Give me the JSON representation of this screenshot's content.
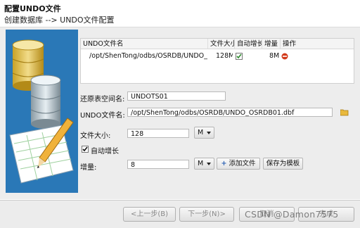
{
  "header": {
    "title": "配置UNDO文件",
    "subtitle": "创建数据库 --> UNDO文件配置"
  },
  "table": {
    "columns": [
      "UNDO文件名",
      "文件大小",
      "自动增长",
      "增量",
      "操作"
    ],
    "rows": [
      {
        "name": "/opt/ShenTong/odbs/OSRDB/UNDO_OS",
        "size": "128M",
        "autogrow": true,
        "increment": "8M"
      }
    ]
  },
  "form": {
    "tablespace_label": "还原表空间名:",
    "tablespace_value": "UNDOTS01",
    "undo_file_label": "UNDO文件名:",
    "undo_file_value": "/opt/ShenTong/odbs/OSRDB/UNDO_OSRDB01.dbf",
    "file_size_label": "文件大小:",
    "file_size_value": "128",
    "file_size_unit": "M",
    "autogrow_label": "自动增长",
    "autogrow_checked": true,
    "increment_label": "增量:",
    "increment_value": "8",
    "increment_unit": "M",
    "add_file_button": "添加文件",
    "save_template_button": "保存为模板"
  },
  "footer": {
    "prev": "<上一步(B)",
    "next": "下一步(N)>",
    "cancel": "取消",
    "finish": "完成"
  },
  "watermark": "CSDN @Damon7575",
  "colors": {
    "art_background": "#2a78b7",
    "check_accent": "#2e8b2e",
    "delete_icon": "#d23a1a"
  }
}
